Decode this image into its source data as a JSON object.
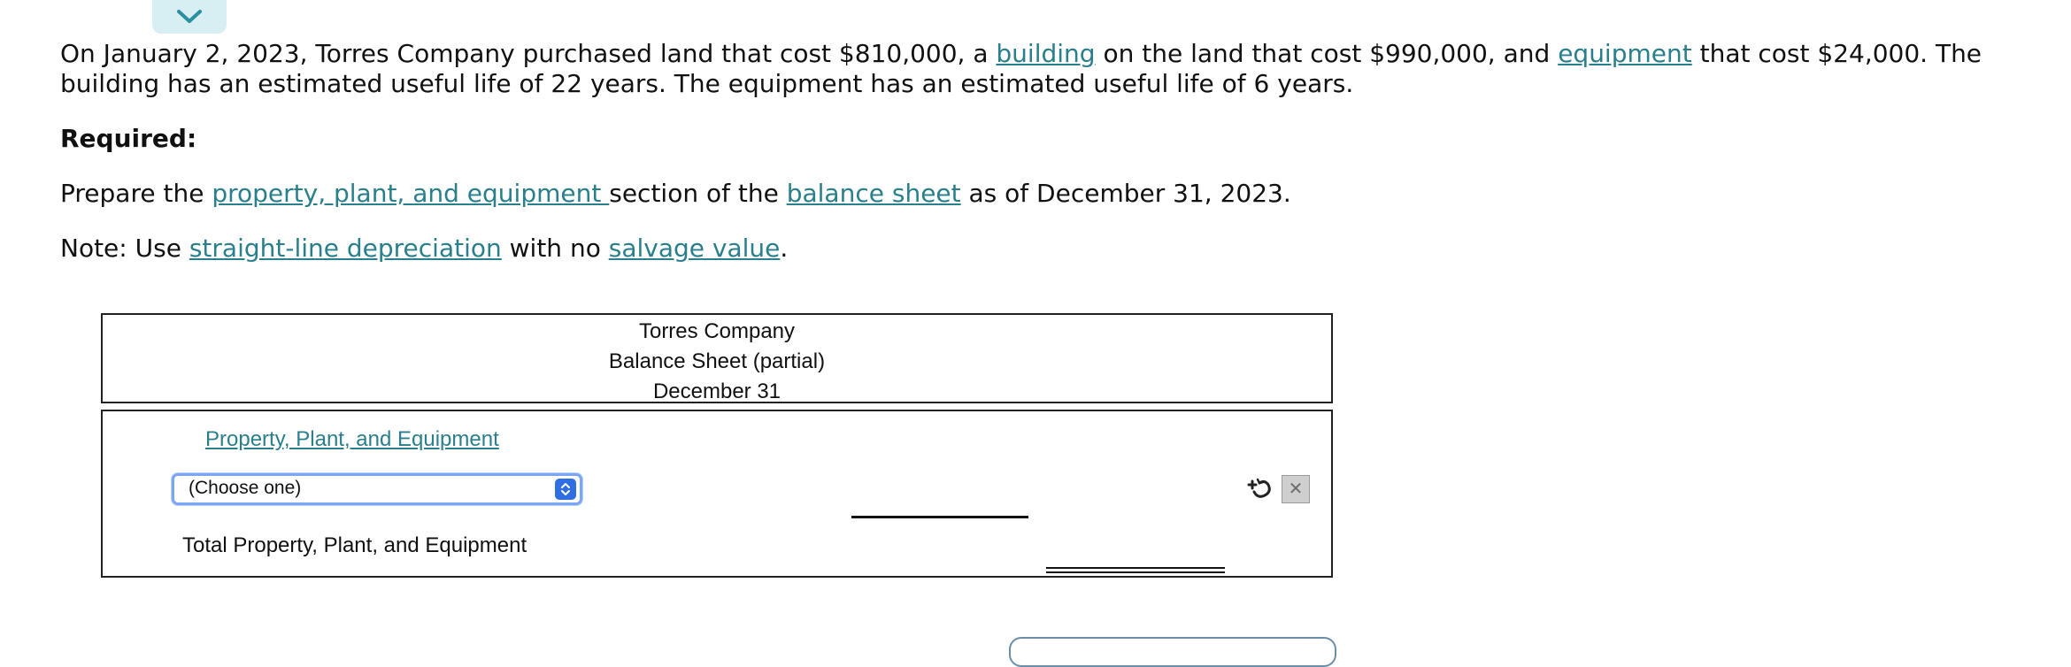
{
  "toggle": {
    "icon": "chevron-down-icon",
    "color": "#2a7f8c"
  },
  "problem": {
    "p1": "On January 2, 2023, Torres Company purchased land that cost $810,000, a ",
    "link_building": "building",
    "p2": " on the land that cost $990,000, and ",
    "link_equipment": "equipment",
    "p3": " that cost $24,000. The building has an estimated useful life of 22 years. The equipment has an estimated useful life of 6 years."
  },
  "required_label": "Required:",
  "instruction": {
    "t1": "Prepare the ",
    "link_ppe": "property, plant, and equipment ",
    "t2": "section of the ",
    "link_balance_sheet": "balance sheet",
    "t3": " as of December 31, 2023."
  },
  "note": {
    "t1": "Note: Use ",
    "link_straight_line": "straight-line depreciation",
    "t2": " with no ",
    "link_salvage": "salvage value",
    "t3": "."
  },
  "statement_header": {
    "company": "Torres Company",
    "title": "Balance Sheet (partial)",
    "date": "December 31"
  },
  "statement_body": {
    "section_heading": "Property, Plant, and Equipment",
    "account_select": {
      "selected": "(Choose one)"
    },
    "total_label": "Total Property, Plant, and Equipment",
    "add_row_icon": "add-row-icon",
    "delete_row_icon": "close-icon"
  },
  "colors": {
    "link": "#2a7f8c",
    "select_border": "#7aa6f5",
    "select_arrow_bg": "#2f6fe3"
  }
}
